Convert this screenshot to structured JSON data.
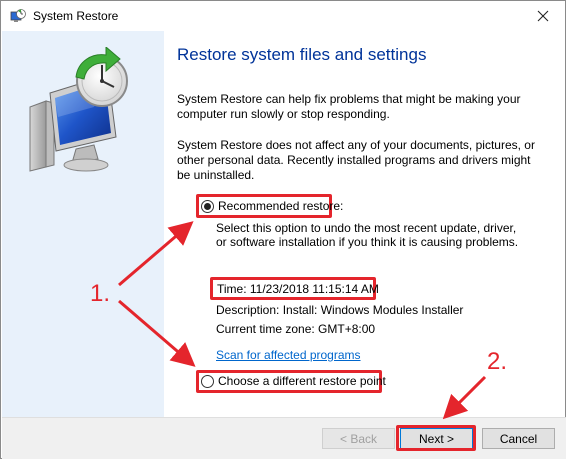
{
  "window": {
    "title": "System Restore"
  },
  "content": {
    "heading": "Restore system files and settings",
    "para1": "System Restore can help fix problems that might be making your computer run slowly or stop responding.",
    "para2": "System Restore does not affect any of your documents, pictures, or other personal data. Recently installed programs and drivers might be uninstalled.",
    "recommended": {
      "label": "Recommended restore:",
      "checked": true,
      "description_line1": "Select this option to undo the most recent update, driver,",
      "description_line2": "or software installation if you think it is causing problems.",
      "time": "Time: 11/23/2018 11:15:14 AM",
      "description": "Description: Install: Windows Modules Installer",
      "timezone": "Current time zone: GMT+8:00",
      "scan_link": "Scan for affected programs"
    },
    "different": {
      "label": "Choose a different restore point",
      "checked": false
    }
  },
  "footer": {
    "back_label": "< Back",
    "next_label": "Next >",
    "cancel_label": "Cancel"
  },
  "annotations": {
    "step1": "1.",
    "step2": "2.",
    "color": "#e4252c"
  },
  "icons": {
    "title": "system-restore-icon",
    "close": "close-icon",
    "hero": "computer-restore-clock-icon"
  }
}
